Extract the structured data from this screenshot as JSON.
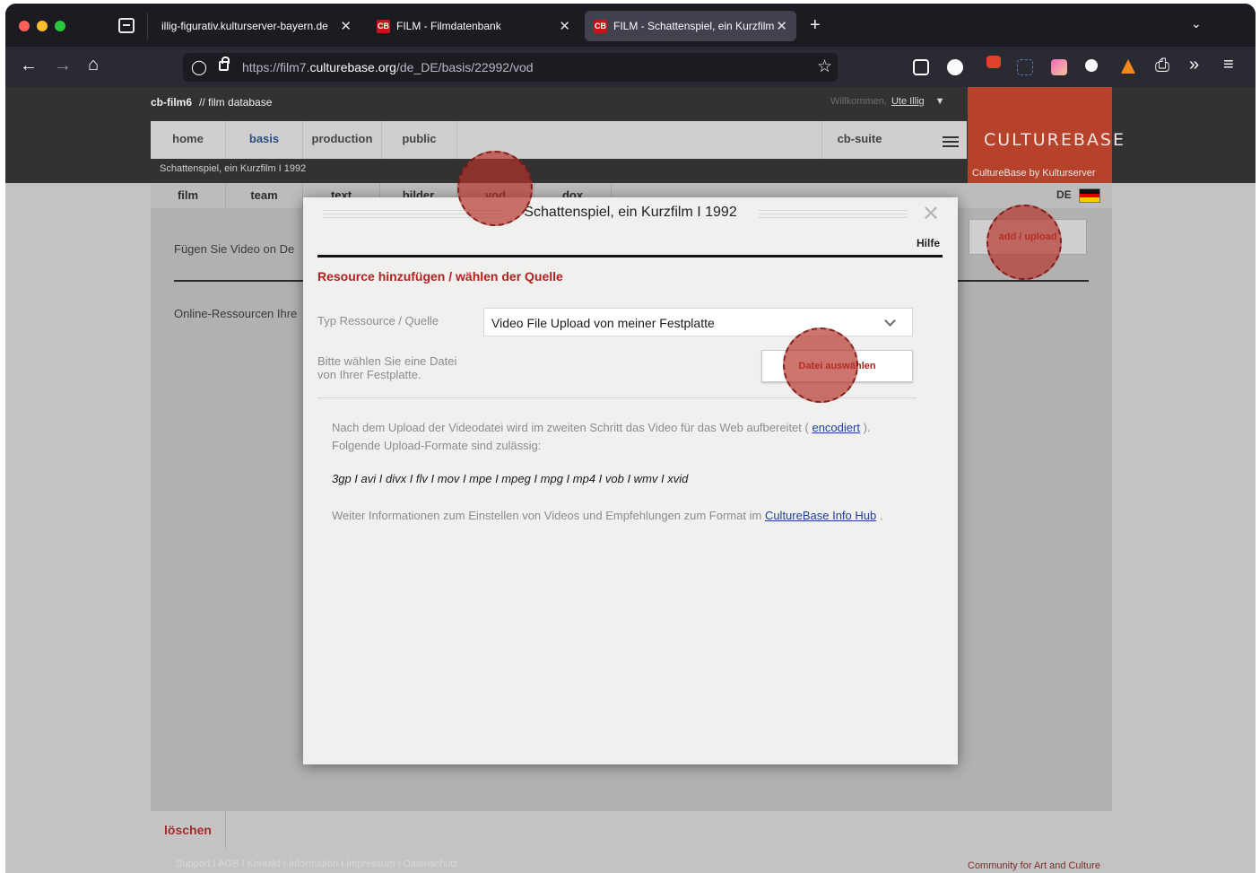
{
  "browser": {
    "tabs": [
      {
        "label": "illig-figurativ.kulturserver-bayern.de"
      },
      {
        "label": "FILM - Filmdatenbank",
        "favicon": "CB"
      },
      {
        "label": "FILM - Schattenspiel, ein Kurzfilm",
        "favicon": "CB",
        "active": true
      }
    ],
    "url_prefix": "https://film7.",
    "url_domain": "culturebase.org",
    "url_path": "/de_DE/basis/22992/vod",
    "close_glyph": "✕",
    "new_tab_glyph": "+"
  },
  "site": {
    "brand": "cb-film6",
    "brand_sub": "// film database",
    "welcome": "Willkommen,",
    "user": "Ute Illig",
    "user_arrow": "▼",
    "main_nav": [
      "home",
      "basis",
      "production",
      "public"
    ],
    "suite": "cb-suite",
    "logo": "CULTUREBASE",
    "breadcrumb": "Schattenspiel, ein Kurzfilm I 1992",
    "byline": "CultureBase by Kulturserver",
    "sub_nav": [
      "film",
      "team",
      "text",
      "bilder",
      "vod",
      "dox"
    ],
    "lang": "DE",
    "bg_text1": "Fügen Sie Video on De",
    "bg_text2": "Online-Ressourcen Ihre",
    "add_upload": "add / upload",
    "delete": "löschen",
    "footer_links": "Support I AGB I Kontakt I Information I Impressum I Datenschutz",
    "footer_right": "Community for Art and Culture"
  },
  "modal": {
    "title": "Schattenspiel, ein Kurzfilm I 1992",
    "close": "✕",
    "help": "Hilfe",
    "heading": "Resource hinzufügen / wählen der Quelle",
    "type_label": "Typ Ressource / Quelle",
    "type_value": "Video File Upload von meiner Festplatte",
    "file_label_1": "Bitte wählen Sie eine Datei",
    "file_label_2": "von Ihrer Festplatte.",
    "file_button": "Datei auswählen",
    "info1_pre": "Nach dem Upload der Videodatei wird im zweiten Schritt das Video für das Web aufbereitet (",
    "info1_link": "encodiert",
    "info1_post": "). Folgende Upload-Formate sind zulässig:",
    "formats": "3gp I avi I divx I flv I mov I mpe I mpeg I mpg I mp4 I vob I wmv I xvid",
    "info3_pre": "Weiter Informationen zum Einstellen von Videos und Empfehlungen zum Format im",
    "info3_link": "CultureBase Info Hub",
    "info3_post": "."
  }
}
